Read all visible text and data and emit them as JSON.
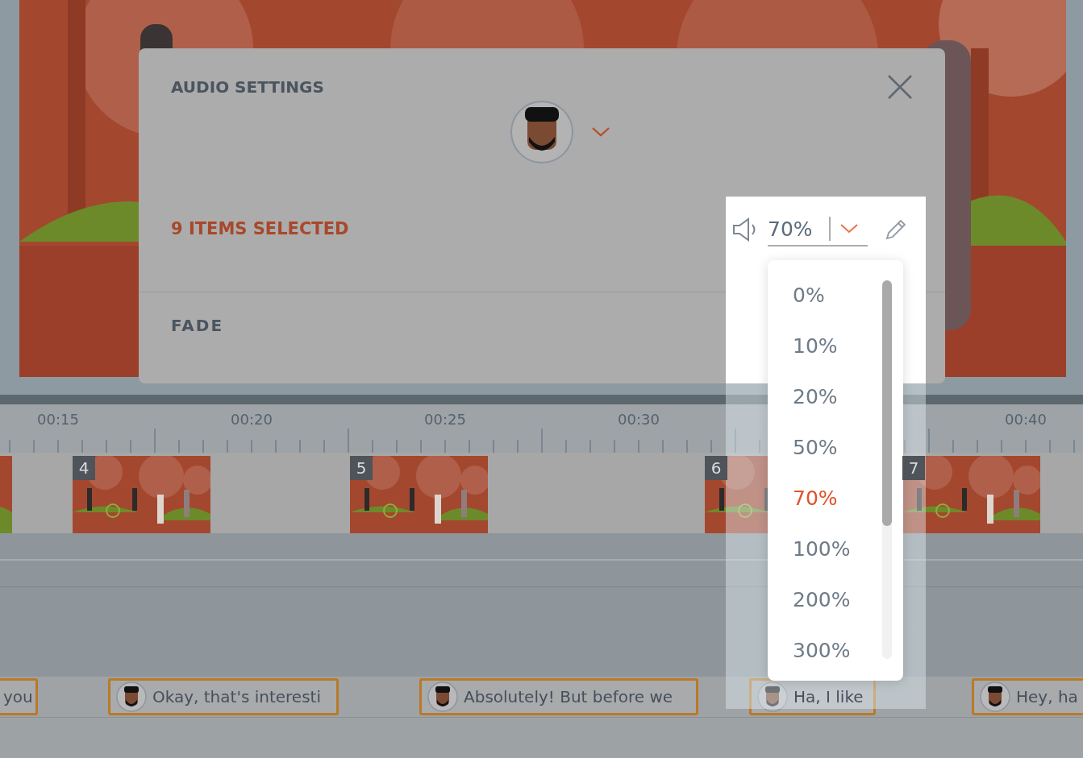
{
  "modal": {
    "title": "AUDIO SETTINGS",
    "selection_label": "9 ITEMS SELECTED",
    "fade_label": "FADE"
  },
  "volume": {
    "value": "70%",
    "options": [
      {
        "label": "0%",
        "selected": false
      },
      {
        "label": "10%",
        "selected": false
      },
      {
        "label": "20%",
        "selected": false
      },
      {
        "label": "50%",
        "selected": false
      },
      {
        "label": "70%",
        "selected": true
      },
      {
        "label": "100%",
        "selected": false
      },
      {
        "label": "200%",
        "selected": false
      },
      {
        "label": "300%",
        "selected": false
      }
    ]
  },
  "ruler": {
    "labels": [
      "00:15",
      "00:20",
      "00:25",
      "00:30",
      "00:40"
    ]
  },
  "video_clips": [
    {
      "badge": "4"
    },
    {
      "badge": "5"
    },
    {
      "badge": "6"
    },
    {
      "badge": "7"
    }
  ],
  "audio_clips": [
    {
      "text": "you",
      "avatar": false
    },
    {
      "text": "Okay, that's interesti",
      "avatar": true
    },
    {
      "text": "Absolutely! But before we",
      "avatar": true
    },
    {
      "text": "Ha, I like",
      "avatar": true
    },
    {
      "text": "Hey, ha",
      "avatar": true
    }
  ]
}
